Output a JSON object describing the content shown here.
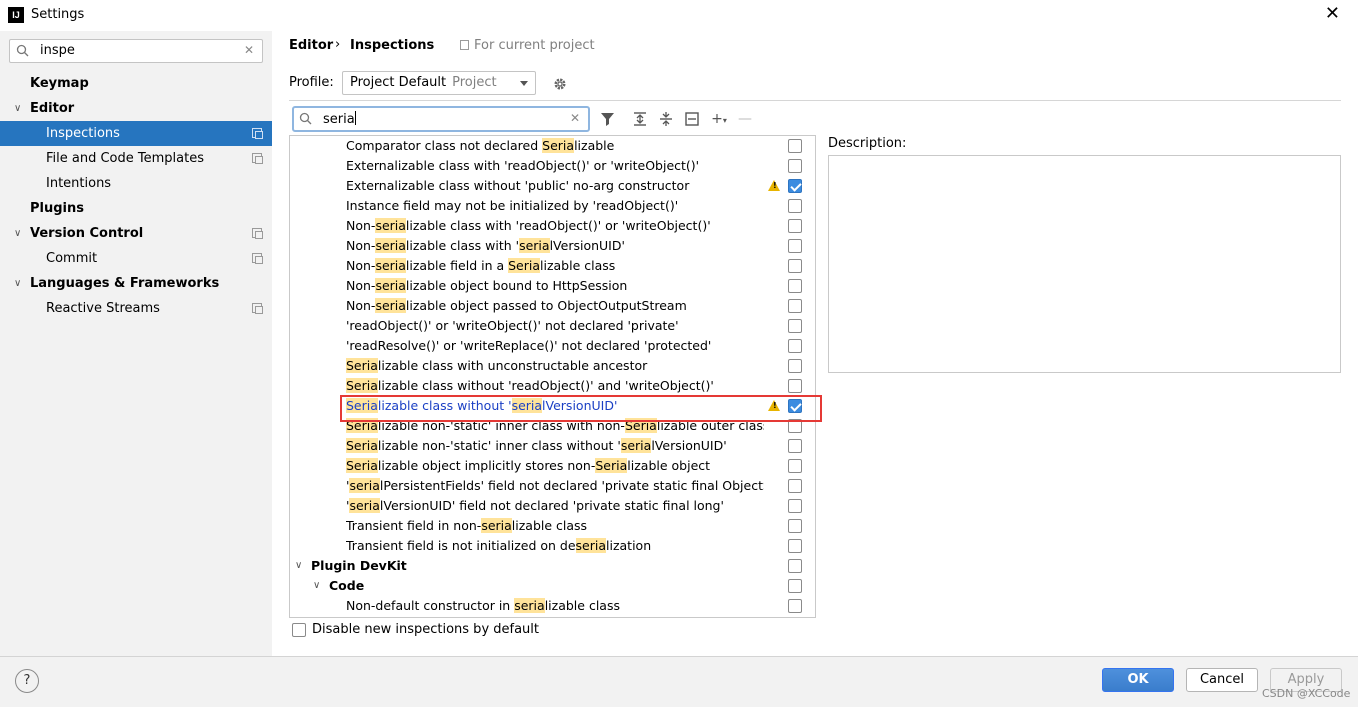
{
  "window": {
    "title": "Settings",
    "logo": "IJ"
  },
  "sidebar": {
    "search_value": "inspe",
    "items": [
      {
        "label": "Keymap"
      },
      {
        "label": "Editor"
      },
      {
        "label": "Inspections"
      },
      {
        "label": "File and Code Templates"
      },
      {
        "label": "Intentions"
      },
      {
        "label": "Plugins"
      },
      {
        "label": "Version Control"
      },
      {
        "label": "Commit"
      },
      {
        "label": "Languages & Frameworks"
      },
      {
        "label": "Reactive Streams"
      }
    ]
  },
  "header": {
    "crumb1": "Editor",
    "separator": "›",
    "crumb2": "Inspections",
    "scope": "For current project"
  },
  "profile": {
    "label": "Profile:",
    "name": "Project Default",
    "scope": "Project"
  },
  "filter": {
    "value": "seria"
  },
  "tree_rows": [
    {
      "pre": "Comparator class not declared ",
      "hl": "Seria",
      "post": "lizable",
      "checked": false
    },
    {
      "pre": "Externalizable class with 'readObject()' or 'writeObject()'",
      "hl": "",
      "post": "",
      "checked": false
    },
    {
      "pre": "Externalizable class without 'public' no-arg constructor",
      "hl": "",
      "post": "",
      "checked": true,
      "warn": true
    },
    {
      "pre": "Instance field may not be initialized by 'readObject()'",
      "hl": "",
      "post": "",
      "checked": false
    },
    {
      "pre": "Non-",
      "hl": "seria",
      "post": "lizable class with 'readObject()' or 'writeObject()'",
      "checked": false
    },
    {
      "pre": "Non-",
      "hl": "seria",
      "post": "lizable class with '",
      "hl2": "seria",
      "post2": "lVersionUID'",
      "checked": false
    },
    {
      "pre": "Non-",
      "hl": "seria",
      "post": "lizable field in a ",
      "hl2": "Seria",
      "post2": "lizable class",
      "checked": false
    },
    {
      "pre": "Non-",
      "hl": "seria",
      "post": "lizable object bound to HttpSession",
      "checked": false
    },
    {
      "pre": "Non-",
      "hl": "seria",
      "post": "lizable object passed to ObjectOutputStream",
      "checked": false
    },
    {
      "pre": "'readObject()' or 'writeObject()' not declared 'private'",
      "hl": "",
      "post": "",
      "checked": false
    },
    {
      "pre": "'readResolve()' or 'writeReplace()' not declared 'protected'",
      "hl": "",
      "post": "",
      "checked": false
    },
    {
      "pre": "",
      "hl": "Seria",
      "post": "lizable class with unconstructable ancestor",
      "checked": false
    },
    {
      "pre": "",
      "hl": "Seria",
      "post": "lizable class without 'readObject()' and 'writeObject()'",
      "checked": false
    },
    {
      "pre": "",
      "hl": "Seria",
      "post": "lizable class without '",
      "hl2": "seria",
      "post2": "lVersionUID'",
      "checked": true,
      "warn": true,
      "selected": true
    },
    {
      "pre": "",
      "hl": "Seria",
      "post": "lizable non-'static' inner class with non-",
      "hl2": "Seria",
      "post2": "lizable outer class",
      "checked": false
    },
    {
      "pre": "",
      "hl": "Seria",
      "post": "lizable non-'static' inner class without '",
      "hl2": "seria",
      "post2": "lVersionUID'",
      "checked": false
    },
    {
      "pre": "",
      "hl": "Seria",
      "post": "lizable object implicitly stores non-",
      "hl2": "Seria",
      "post2": "lizable object",
      "checked": false
    },
    {
      "pre": "'",
      "hl": "seria",
      "post": "lPersistentFields' field not declared 'private static final ObjectStrear",
      "checked": false
    },
    {
      "pre": "'",
      "hl": "seria",
      "post": "lVersionUID' field not declared 'private static final long'",
      "checked": false
    },
    {
      "pre": "Transient field in non-",
      "hl": "seria",
      "post": "lizable class",
      "checked": false
    },
    {
      "pre": "Transient field is not initialized on de",
      "hl": "seria",
      "post": "lization",
      "checked": false
    },
    {
      "pre": "Plugin DevKit",
      "hl": "",
      "post": "",
      "checked": false,
      "group": 1
    },
    {
      "pre": "Code",
      "hl": "",
      "post": "",
      "checked": false,
      "group": 2
    },
    {
      "pre": "Non-default constructor in ",
      "hl": "seria",
      "post": "lizable class",
      "checked": false
    }
  ],
  "description_label": "Description:",
  "disable_label": "Disable new inspections by default",
  "buttons": {
    "help": "?",
    "ok": "OK",
    "cancel": "Cancel",
    "apply": "Apply"
  },
  "watermark": "CSDN @XCCode",
  "colors": {
    "selection": "#2675bf",
    "highlight": "#ffe39a",
    "ok": "#3a7dcc",
    "warning": "#e8b400",
    "callout": "#e53935"
  }
}
